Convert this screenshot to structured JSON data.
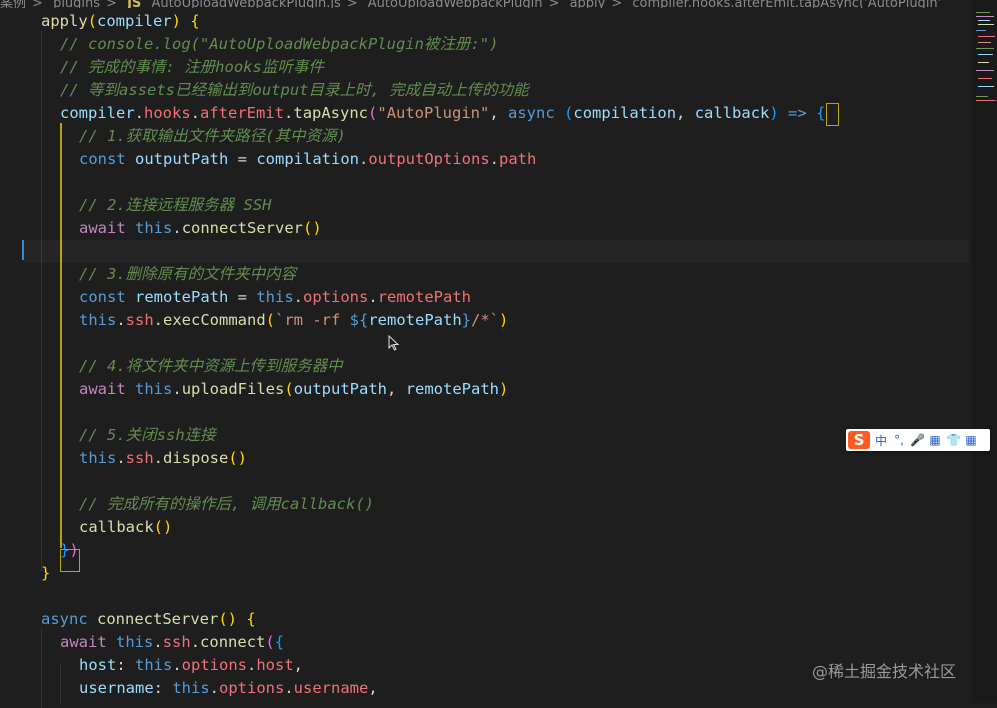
{
  "breadcrumb": {
    "items": [
      "案例",
      "plugins",
      "AutoUploadWebpackPlugin.js",
      "AutoUploadWebpackPlugin",
      "apply",
      "compiler.hooks.afterEmit.tapAsync('AutoPlugin'"
    ],
    "file_badge": "JS"
  },
  "code": {
    "apply": "apply",
    "compiler_param": "compiler",
    "c1": "// console.log(\"AutoUploadWebpackPlugin被注册:\")",
    "c2": "// 完成的事情: 注册hooks监听事件",
    "c3": "// 等到assets已经输出到output目录上时, 完成自动上传的功能",
    "compiler": "compiler",
    "hooks": "hooks",
    "afterEmit": "afterEmit",
    "tapAsync": "tapAsync",
    "plugin_name": "\"AutoPlugin\"",
    "async": "async",
    "compilation": "compilation",
    "callback": "callback",
    "arrow": "=>",
    "s1": "// 1.获取输出文件夹路径(其中资源)",
    "const": "const",
    "outputPath": "outputPath",
    "outputOptions": "outputOptions",
    "path": "path",
    "s2": "// 2.连接远程服务器 SSH",
    "await": "await",
    "this": "this",
    "connectServer": "connectServer",
    "s3": "// 3.删除原有的文件夹中内容",
    "remotePath": "remotePath",
    "options": "options",
    "ssh": "ssh",
    "execCommand": "execCommand",
    "tpl_start": "`rm -rf ",
    "tpl_open": "${",
    "tpl_close": "}",
    "tpl_end": "/*`",
    "s4": "// 4.将文件夹中资源上传到服务器中",
    "uploadFiles": "uploadFiles",
    "s5": "// 5.关闭ssh连接",
    "dispose": "dispose",
    "s6": "// 完成所有的操作后, 调用callback()",
    "connect": "connect",
    "host": "host",
    "username": "username"
  },
  "ime_toolbar": {
    "logo": "S",
    "items": [
      "中",
      "°,",
      "🎤",
      "▦",
      "👕",
      "▦"
    ]
  },
  "watermark": "@稀土掘金技术社区",
  "colors": {
    "background": "#1e1e1e",
    "keyword": "#569cd6",
    "control": "#c586c0",
    "function": "#dcdcaa",
    "variable": "#9cdcfe",
    "property": "#f07178",
    "string": "#ce9178",
    "comment": "#6a9955",
    "bracket_gold": "#ffd700",
    "bracket_purple": "#da70d6",
    "bracket_blue": "#179fff"
  }
}
